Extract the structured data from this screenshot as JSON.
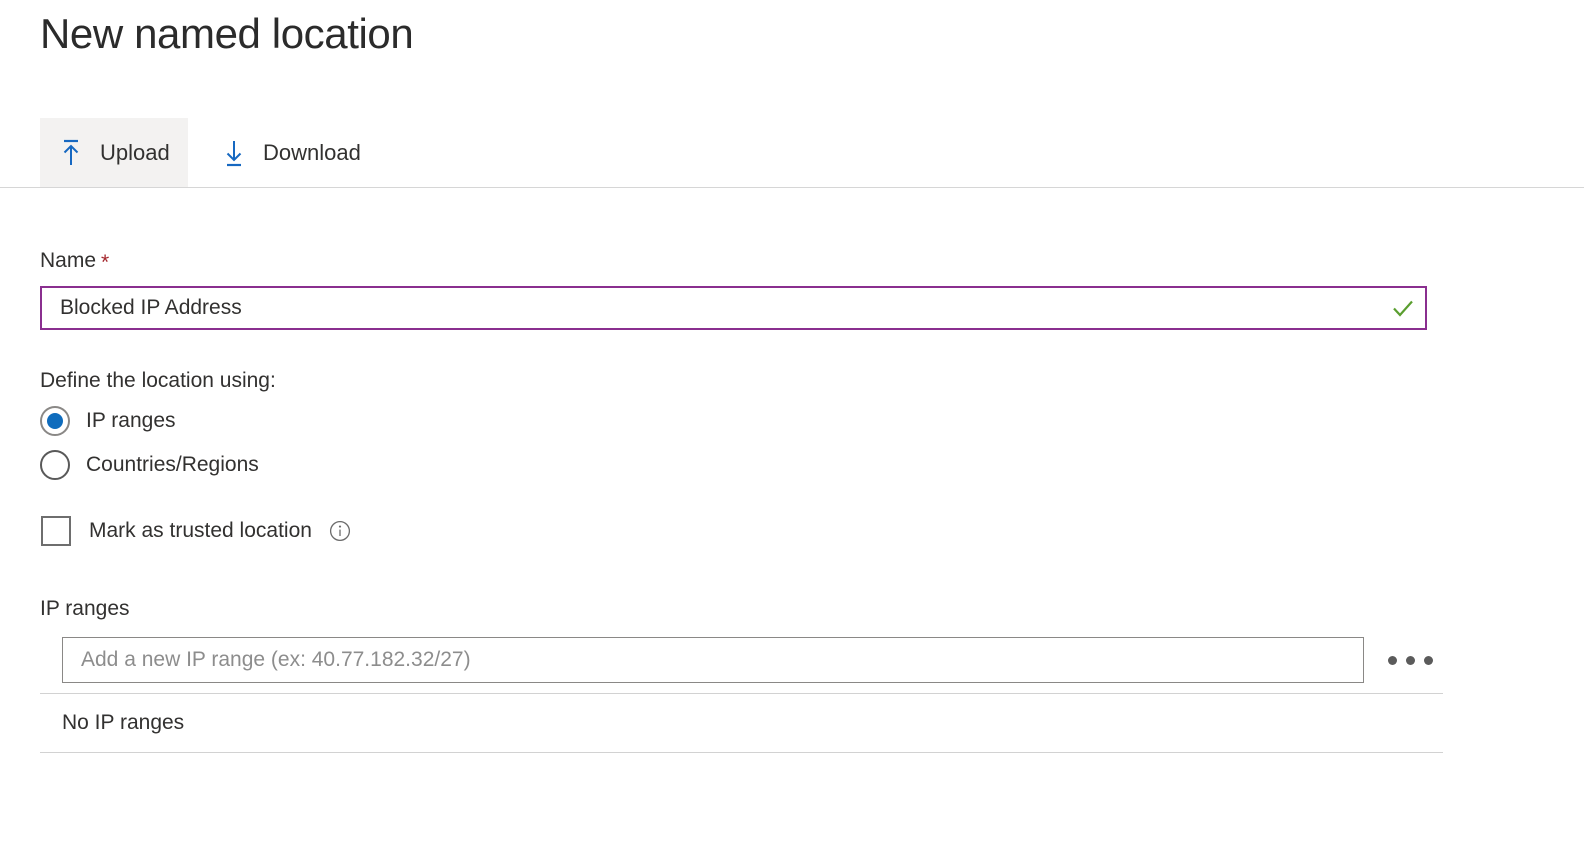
{
  "page": {
    "title": "New named location"
  },
  "toolbar": {
    "upload": {
      "label": "Upload",
      "icon": "upload-icon"
    },
    "download": {
      "label": "Download",
      "icon": "download-icon"
    }
  },
  "form": {
    "name": {
      "label": "Name",
      "required_marker": "*",
      "value": "Blocked IP Address",
      "validation_icon": "checkmark-icon",
      "validation_color": "#5a9e2f",
      "focus_border_color": "#8a2f8f"
    },
    "define_location": {
      "label": "Define the location using:",
      "selected": "IP ranges",
      "options": [
        {
          "label": "IP ranges",
          "selected": true
        },
        {
          "label": "Countries/Regions",
          "selected": false
        }
      ],
      "accent_color": "#0f6cbd"
    },
    "trusted": {
      "label": "Mark as trusted location",
      "checked": false,
      "info_icon": "info-icon"
    },
    "ip_ranges": {
      "label": "IP ranges",
      "input_value": "",
      "input_placeholder": "Add a new IP range (ex: 40.77.182.32/27)",
      "more_actions_icon": "ellipsis-icon",
      "empty_text": "No IP ranges"
    }
  }
}
